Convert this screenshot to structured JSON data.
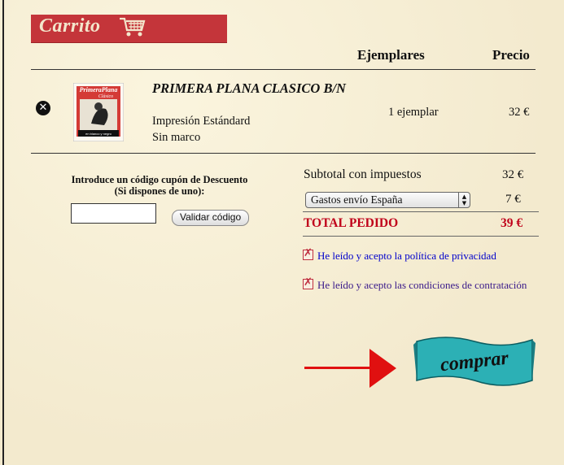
{
  "header": {
    "title": "Carrito"
  },
  "columns": {
    "quantity": "Ejemplares",
    "price": "Precio"
  },
  "item": {
    "cover_title": "PrimeraPlana",
    "cover_subtitle": "Clásico",
    "cover_caption": "en blanco y negro",
    "title": "PRIMERA PLANA CLASICO B/N",
    "print_type": "Impresión Estándard",
    "frame": "Sin marco",
    "quantity": "1 ejemplar",
    "price": "32 €",
    "remove_icon": "x-circle-icon"
  },
  "coupon": {
    "label_line1": "Introduce un código cupón de Descuento",
    "label_line2": "(Si dispones de uno):",
    "input_value": "",
    "button_label": "Validar código"
  },
  "summary": {
    "subtotal_label": "Subtotal con impuestos",
    "subtotal_value": "32 €",
    "shipping_selected": "Gastos envío España",
    "shipping_value": "7 €",
    "total_label": "TOTAL PEDIDO",
    "total_value": "39 €"
  },
  "consents": [
    {
      "label": "He leído y acepto la política de privacidad",
      "checked": true,
      "color": "#0000cc"
    },
    {
      "label": "He leído y acepto las condiciones de contratación",
      "checked": true,
      "color": "#3a1a8a"
    }
  ],
  "buy_button": {
    "label": "comprar"
  },
  "colors": {
    "accent": "#c4353a",
    "total": "#c0001a",
    "ribbon": "#2cb0b5",
    "arrow": "#e01010"
  }
}
